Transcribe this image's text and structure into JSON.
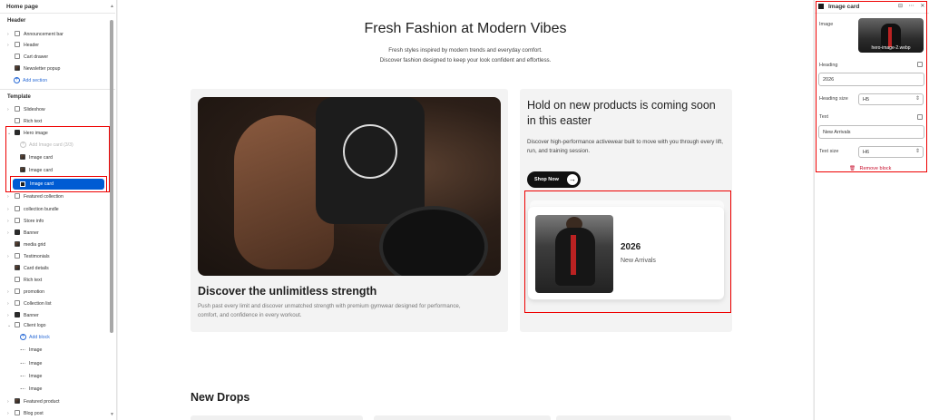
{
  "left_panel": {
    "title": "Home page",
    "header_section": "Header",
    "header_items": [
      "Announcement bar",
      "Header",
      "Cart drawer",
      "Newsletter popup"
    ],
    "add_section": "Add section",
    "template_section": "Template",
    "template_items_top": [
      "Slideshow",
      "Rich text",
      "Hero image"
    ],
    "hero_children": [
      "Add Image card (3/3)",
      "Image card",
      "Image card",
      "Image card"
    ],
    "template_items_rest": [
      "Featured collection",
      "collection bundle",
      "Store info",
      "Banner",
      "media grid",
      "Testimonials",
      "Card details",
      "Rich text",
      "promotion",
      "Collection list",
      "Banner",
      "Client logo"
    ],
    "client_logo_children": [
      "Add block",
      "Image",
      "Image",
      "Image",
      "Image"
    ],
    "bottom_items": [
      "Featured product",
      "Blog post"
    ]
  },
  "preview": {
    "title": "Fresh Fashion at Modern Vibes",
    "subtitle_lines": [
      "Fresh styles inspired by modern trends and everyday comfort.",
      "Discover fashion designed to keep your look confident and effortless."
    ],
    "hero_heading": "Discover the unlimitless strength",
    "hero_text": "Push past every limit and discover unmatched strength with premium gymwear designed for performance, comfort, and confidence in every workout.",
    "promo_heading": "Hold on new products is coming soon in this easter",
    "promo_text": "Discover high-performance activewear built to move with you through every lift, run, and training session.",
    "shop_button": "Shop Now",
    "card_year": "2026",
    "card_text": "New Arrivals",
    "new_drops": "New Drops"
  },
  "right_panel": {
    "title": "Image card",
    "image_label": "Image",
    "image_filename": "hero-image-2.webp",
    "heading_label": "Heading",
    "heading_value": "2026",
    "heading_size_label": "Heading size",
    "heading_size_value": "H5",
    "text_label": "Text",
    "text_value": "New Arrivals",
    "text_size_label": "Text size",
    "text_size_value": "H6",
    "remove_block": "Remove block"
  },
  "colors": {
    "accent": "#005bd3",
    "highlight": "#e00000",
    "remove": "#c8102e"
  }
}
